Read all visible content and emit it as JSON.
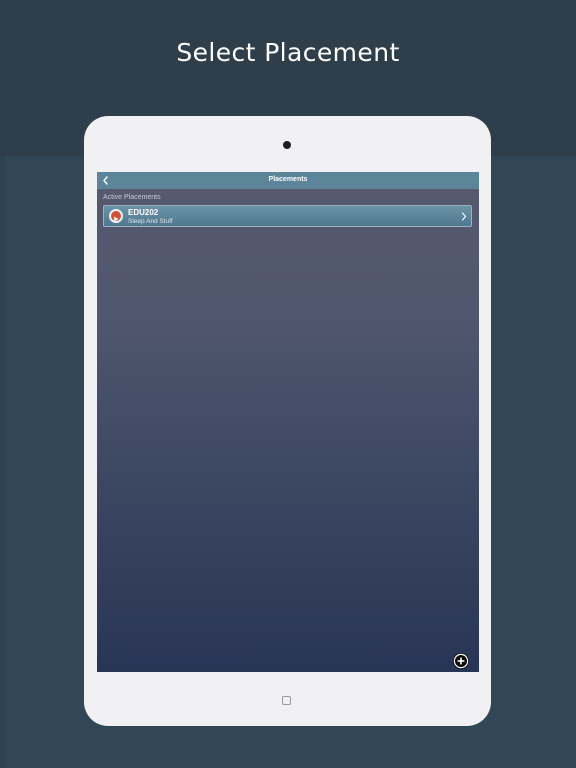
{
  "headline": "Select Placement",
  "screen": {
    "nav_title": "Placements",
    "back_icon": "chevron-left-icon",
    "section_label": "Active Placements",
    "placements": [
      {
        "code": "EDU202",
        "name": "Sleep And Stuff"
      }
    ],
    "add_icon": "plus-circle-icon"
  },
  "colors": {
    "page_bg": "#2e3f4b",
    "navbar": "#5d8599",
    "row_accent": "#d1523a"
  }
}
